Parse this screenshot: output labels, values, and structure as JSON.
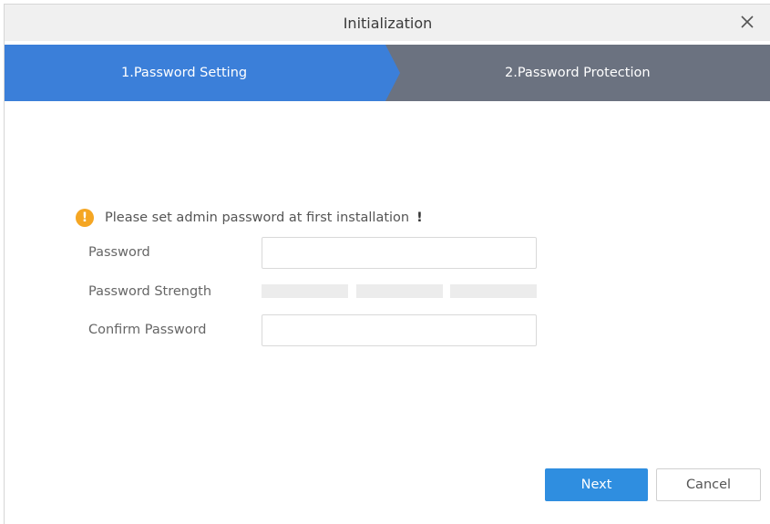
{
  "window": {
    "title": "Initialization"
  },
  "steps": [
    {
      "label": "1.Password Setting",
      "active": true
    },
    {
      "label": "2.Password Protection",
      "active": false
    }
  ],
  "notice": {
    "text": "Please set admin password at first installation",
    "emphasis": "!"
  },
  "form": {
    "password_label": "Password",
    "password_value": "",
    "strength_label": "Password Strength",
    "confirm_label": "Confirm Password",
    "confirm_value": ""
  },
  "buttons": {
    "next": "Next",
    "cancel": "Cancel"
  },
  "colors": {
    "accent": "#3b7fd9",
    "step_inactive": "#6b7280",
    "primary_button": "#2f8ee0",
    "warning": "#f5a623"
  },
  "icons": {
    "close": "close-icon",
    "warning": "warning-icon"
  }
}
